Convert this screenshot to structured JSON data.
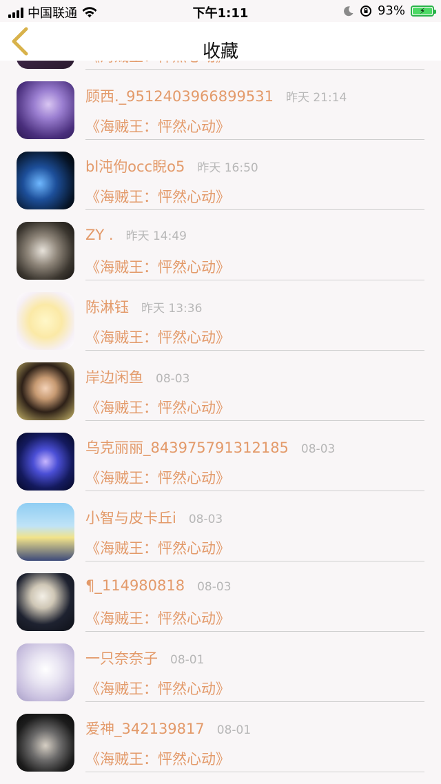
{
  "status_bar": {
    "carrier": "中国联通",
    "time": "下午1:11",
    "battery_percent": "93%",
    "battery_level": 0.93
  },
  "nav": {
    "title": "收藏"
  },
  "list": {
    "partial_item": {
      "book": "《海贼王：怦然心动》"
    },
    "items": [
      {
        "name": "顾西._9512403966899531",
        "time": "昨天 21:14",
        "book": "《海贼王：怦然心动》"
      },
      {
        "name": "bl沌佝occ睨o5",
        "time": "昨天 16:50",
        "book": "《海贼王：怦然心动》"
      },
      {
        "name": "ZY .",
        "time": "昨天 14:49",
        "book": "《海贼王：怦然心动》"
      },
      {
        "name": "陈淋钰",
        "time": "昨天 13:36",
        "book": "《海贼王：怦然心动》"
      },
      {
        "name": "岸边闲鱼",
        "time": "08-03",
        "book": "《海贼王：怦然心动》"
      },
      {
        "name": "乌克丽丽_843975791312185",
        "time": "08-03",
        "book": "《海贼王：怦然心动》"
      },
      {
        "name": "小智与皮卡丘i",
        "time": "08-03",
        "book": "《海贼王：怦然心动》"
      },
      {
        "name": "¶_114980818",
        "time": "08-03",
        "book": "《海贼王：怦然心动》"
      },
      {
        "name": "一只奈奈子",
        "time": "08-01",
        "book": "《海贼王：怦然心动》"
      },
      {
        "name": "爱神_342139817",
        "time": "08-01",
        "book": "《海贼王：怦然心动》"
      }
    ]
  }
}
